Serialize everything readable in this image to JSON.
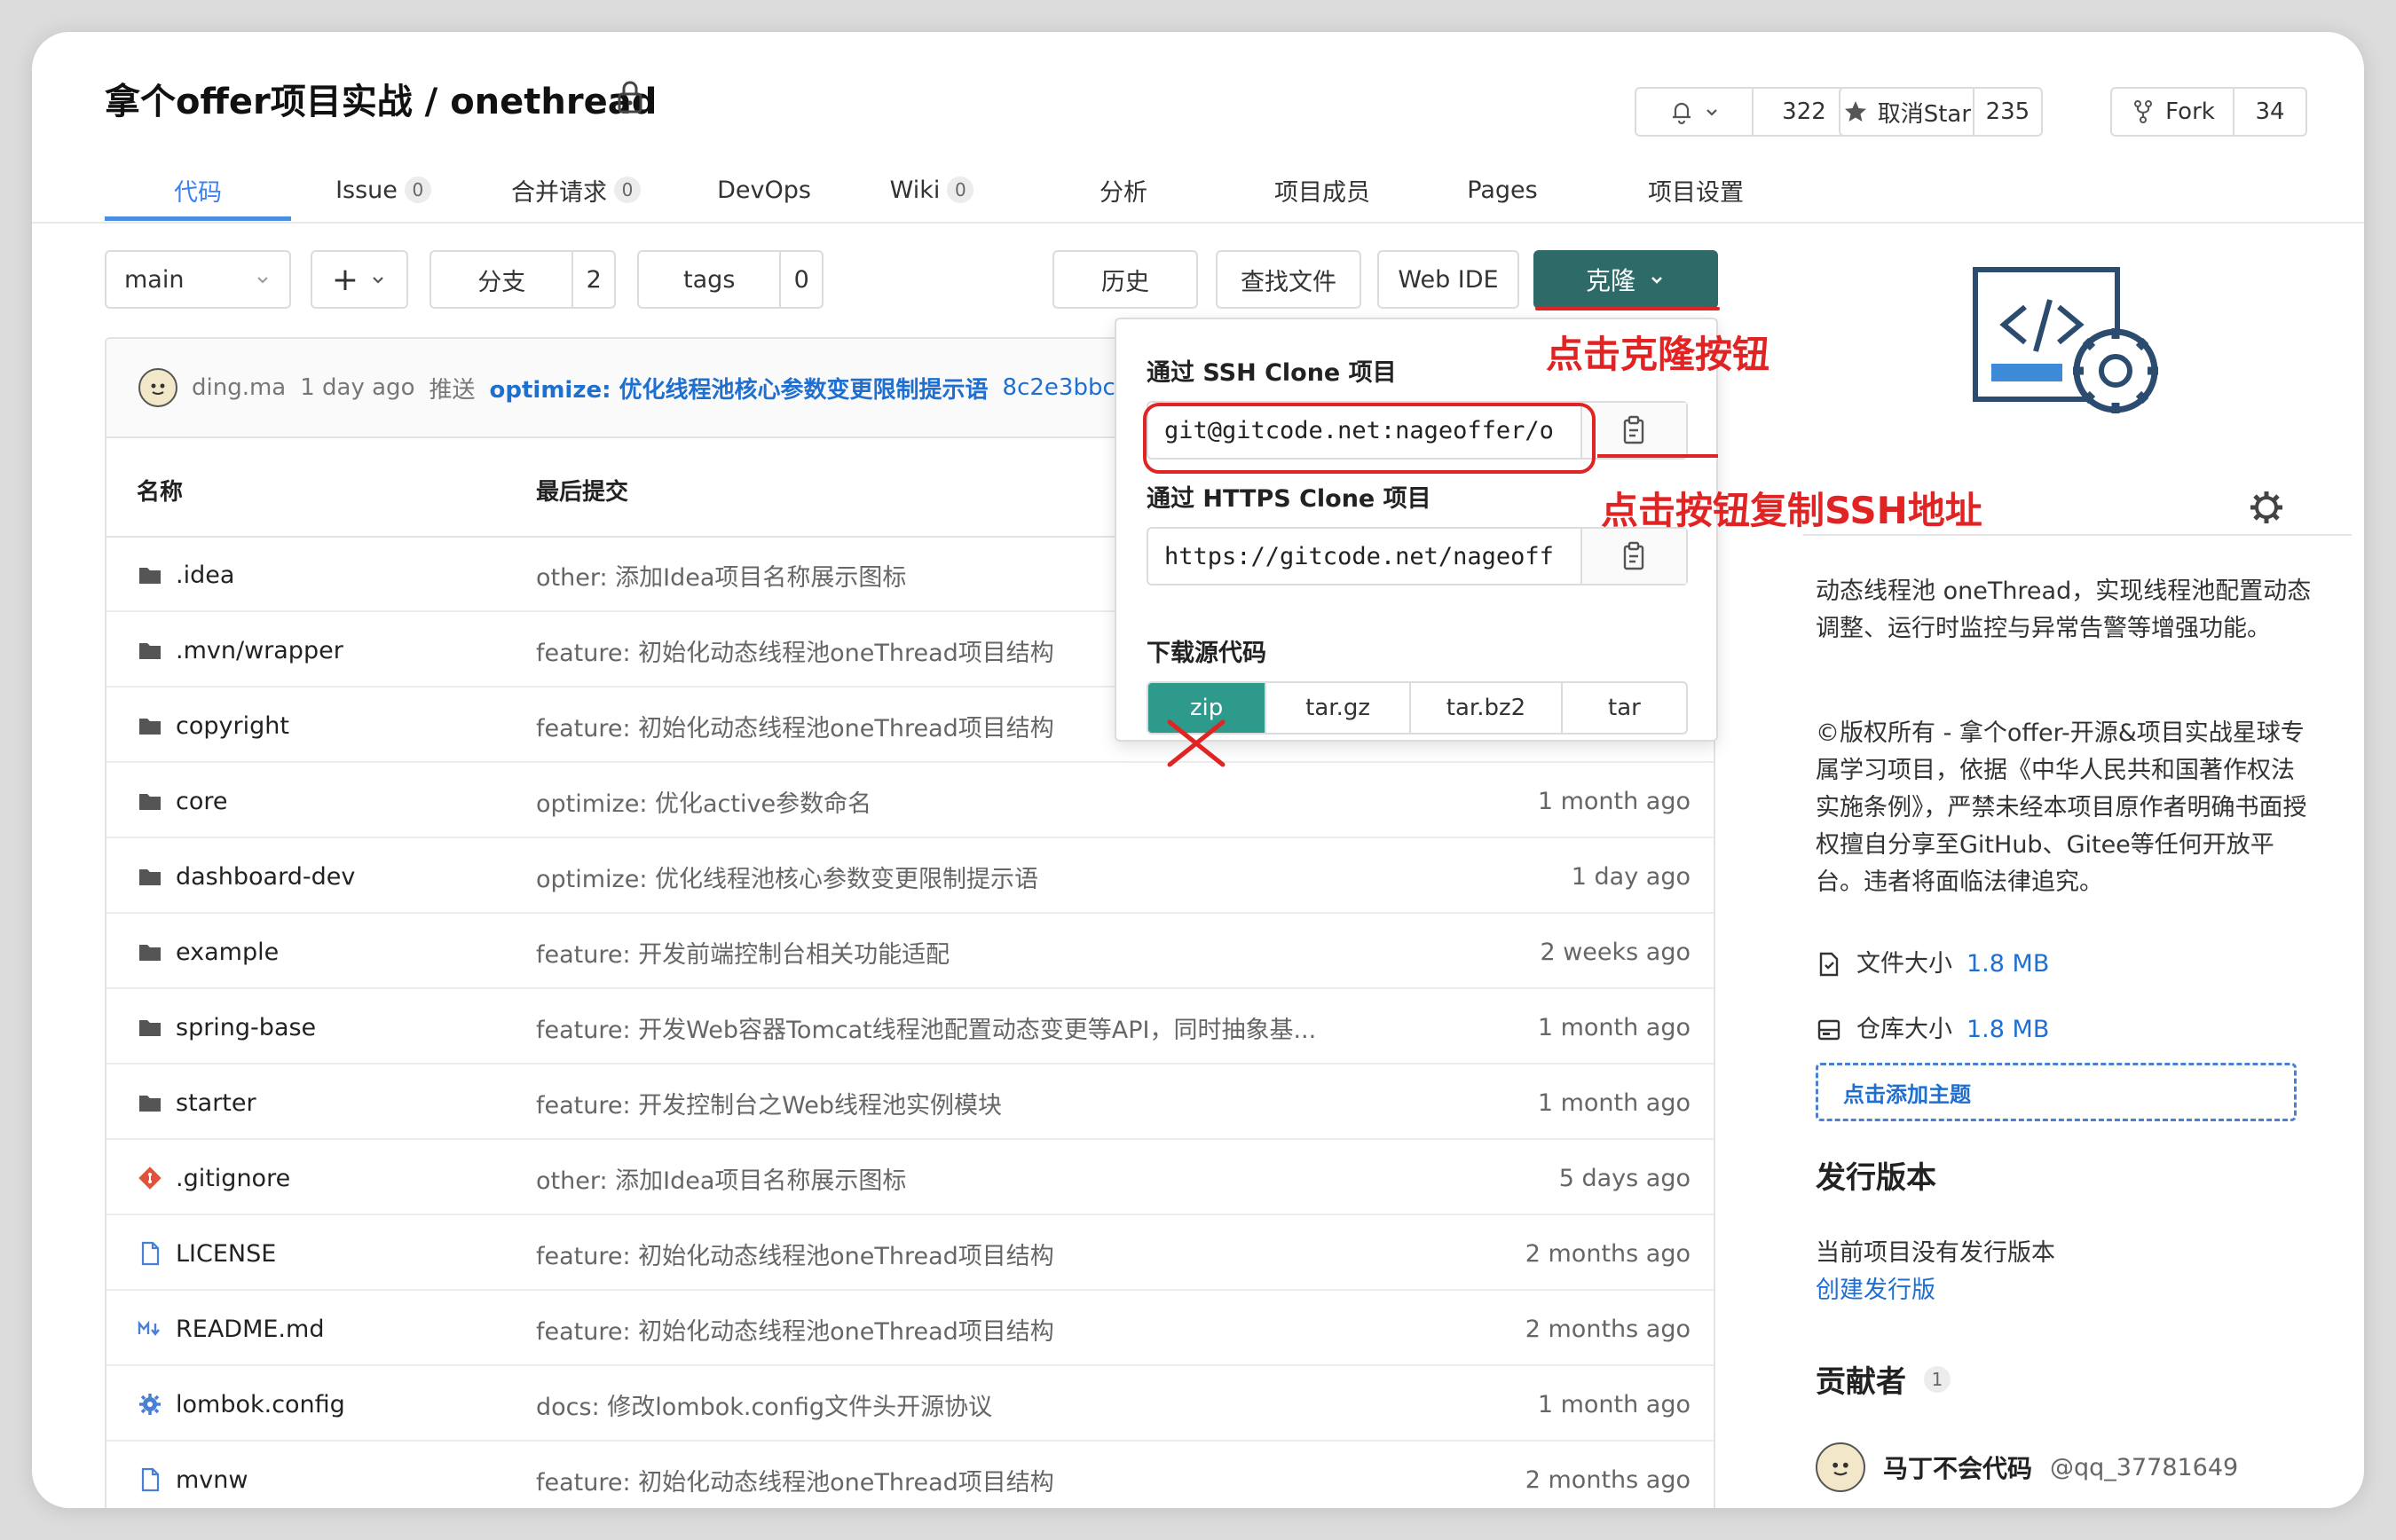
{
  "header": {
    "title": "拿个offer项目实战 / onethread",
    "watch_count": "322",
    "star_label": "取消Star",
    "star_count": "235",
    "fork_label": "Fork",
    "fork_count": "34"
  },
  "nav": {
    "tabs": [
      {
        "label": "代码"
      },
      {
        "label": "Issue",
        "badge": "0"
      },
      {
        "label": "合并请求",
        "badge": "0"
      },
      {
        "label": "DevOps"
      },
      {
        "label": "Wiki",
        "badge": "0"
      },
      {
        "label": "分析"
      },
      {
        "label": "项目成员"
      },
      {
        "label": "Pages"
      },
      {
        "label": "项目设置"
      }
    ]
  },
  "toolbar": {
    "branch": "main",
    "add": "+",
    "branches_label": "分支",
    "branches_count": "2",
    "tags_label": "tags",
    "tags_count": "0",
    "history": "历史",
    "find_file": "查找文件",
    "web_ide": "Web IDE",
    "clone": "克隆"
  },
  "commit": {
    "author": "ding.ma",
    "time": "1 day ago",
    "action": "推送",
    "message": "optimize: 优化线程池核心参数变更限制提示语",
    "hash": "8c2e3bbc"
  },
  "table": {
    "col_name": "名称",
    "col_commit": "最后提交",
    "rows": [
      {
        "name": ".idea",
        "icon": "folder",
        "msg": "other: 添加Idea项目名称展示图标",
        "time": ""
      },
      {
        "name": ".mvn/wrapper",
        "icon": "folder",
        "msg": "feature: 初始化动态线程池oneThread项目结构",
        "time": ""
      },
      {
        "name": "copyright",
        "icon": "folder",
        "msg": "feature: 初始化动态线程池oneThread项目结构",
        "time": ""
      },
      {
        "name": "core",
        "icon": "folder",
        "msg": "optimize: 优化active参数命名",
        "time": "1 month ago"
      },
      {
        "name": "dashboard-dev",
        "icon": "folder",
        "msg": "optimize: 优化线程池核心参数变更限制提示语",
        "time": "1 day ago"
      },
      {
        "name": "example",
        "icon": "folder",
        "msg": "feature: 开发前端控制台相关功能适配",
        "time": "2 weeks ago"
      },
      {
        "name": "spring-base",
        "icon": "folder",
        "msg": "feature: 开发Web容器Tomcat线程池配置动态变更等API，同时抽象基...",
        "time": "1 month ago"
      },
      {
        "name": "starter",
        "icon": "folder",
        "msg": "feature: 开发控制台之Web线程池实例模块",
        "time": "1 month ago"
      },
      {
        "name": ".gitignore",
        "icon": "git",
        "msg": "other: 添加Idea项目名称展示图标",
        "time": "5 days ago"
      },
      {
        "name": "LICENSE",
        "icon": "file",
        "msg": "feature: 初始化动态线程池oneThread项目结构",
        "time": "2 months ago"
      },
      {
        "name": "README.md",
        "icon": "markdown",
        "msg": "feature: 初始化动态线程池oneThread项目结构",
        "time": "2 months ago"
      },
      {
        "name": "lombok.config",
        "icon": "gear",
        "msg": "docs: 修改lombok.config文件头开源协议",
        "time": "1 month ago"
      },
      {
        "name": "mvnw",
        "icon": "file",
        "msg": "feature: 初始化动态线程池oneThread项目结构",
        "time": "2 months ago"
      }
    ]
  },
  "clone_dropdown": {
    "ssh_label": "通过 SSH Clone 项目",
    "ssh_url": "git@gitcode.net:nageoffer/o",
    "https_label": "通过 HTTPS Clone 项目",
    "https_url": "https://gitcode.net/nageoff",
    "download_label": "下载源代码",
    "formats": [
      "zip",
      "tar.gz",
      "tar.bz2",
      "tar"
    ]
  },
  "annotations": {
    "clone_hint": "点击克隆按钮",
    "copy_hint": "点击按钮复制SSH地址"
  },
  "sidebar": {
    "description": "动态线程池 oneThread，实现线程池配置动态调整、运行时监控与异常告警等增强功能。",
    "copyright": "©版权所有 - 拿个offer-开源&项目实战星球专属学习项目，依据《中华人民共和国著作权法实施条例》，严禁未经本项目原作者明确书面授权擅自分享至GitHub、Gitee等任何开放平台。违者将面临法律追究。",
    "file_size_label": "文件大小",
    "file_size": "1.8 MB",
    "repo_size_label": "仓库大小",
    "repo_size": "1.8 MB",
    "add_topic": "点击添加主题",
    "releases_title": "发行版本",
    "no_release": "当前项目没有发行版本",
    "create_release": "创建发行版",
    "contributors_title": "贡献者",
    "contributors_count": "1",
    "contributor_name": "马丁不会代码",
    "contributor_handle": "@qq_37781649"
  },
  "colors": {
    "accent": "#2e6a67",
    "link": "#1f6fd1",
    "annotation": "#e02424",
    "zip_active": "#2e9a8c"
  }
}
